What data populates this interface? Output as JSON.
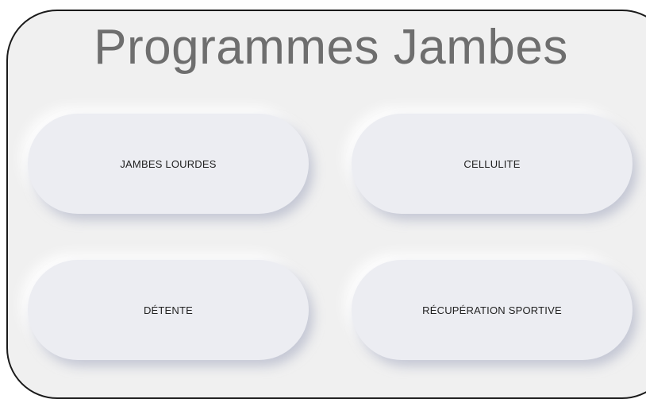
{
  "page": {
    "title": "Programmes Jambes",
    "background_color": "#f0f0f0",
    "button_color": "#ecedf2",
    "title_color": "#6e6e6e"
  },
  "programs": [
    {
      "label": "JAMBES LOURDES"
    },
    {
      "label": "CELLULITE"
    },
    {
      "label": "DÉTENTE"
    },
    {
      "label": "RÉCUPÉRATION SPORTIVE"
    }
  ]
}
